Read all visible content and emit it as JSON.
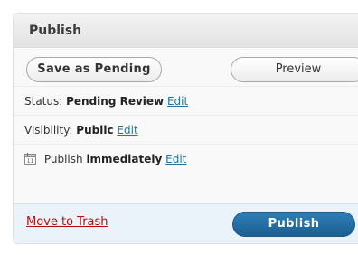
{
  "box": {
    "title": "Publish"
  },
  "actions": {
    "save_label": "Save as Pending",
    "preview_label": "Preview"
  },
  "status": {
    "label": "Status:",
    "value": "Pending Review",
    "edit": "Edit"
  },
  "visibility": {
    "label": "Visibility:",
    "value": "Public",
    "edit": "Edit"
  },
  "schedule": {
    "label": "Publish",
    "value": "immediately",
    "edit": "Edit",
    "icon": "calendar-icon",
    "icon_day": "11"
  },
  "footer": {
    "trash_label": "Move to Trash",
    "publish_label": "Publish"
  },
  "colors": {
    "link": "#21759b",
    "trash": "#bc0b0b",
    "publish_button": "#21759b",
    "footer_background": "#eaf2fa"
  }
}
